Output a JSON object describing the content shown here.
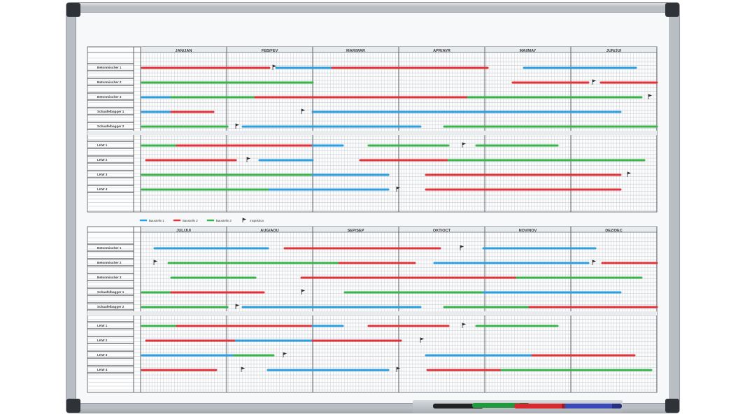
{
  "planner": {
    "top_months": [
      "JAN/JAN",
      "FEB/FEV",
      "MAR/MAR",
      "APR/AVR",
      "MAI/MAY",
      "JUN/JUI"
    ],
    "bottom_months": [
      "JUL/JUI",
      "AUG/AOU",
      "SEP/SEP",
      "OKT/OCT",
      "NOV/NOV",
      "DEZ/DEC"
    ],
    "group_a_rows": [
      "Betonmischer 1",
      "Betonmischer 2",
      "Betonmischer 3",
      "Schaufelbagger 1",
      "Schaufelbagger 2"
    ],
    "group_b_rows": [
      "LKW 1",
      "LKW 2",
      "LKW 3",
      "LKW 4"
    ],
    "legend": [
      {
        "label": "Baustelle 1",
        "color": "#2b9fe0"
      },
      {
        "label": "Baustelle 2",
        "color": "#e2323a"
      },
      {
        "label": "Baustelle 3",
        "color": "#38b54a"
      },
      {
        "label": "Inspektion",
        "color": "#333333"
      }
    ],
    "colors": {
      "blue": "#2b9fe0",
      "red": "#e2323a",
      "green": "#38b54a",
      "grid": "#9aa3aa",
      "text": "#3a3a3a"
    }
  }
}
